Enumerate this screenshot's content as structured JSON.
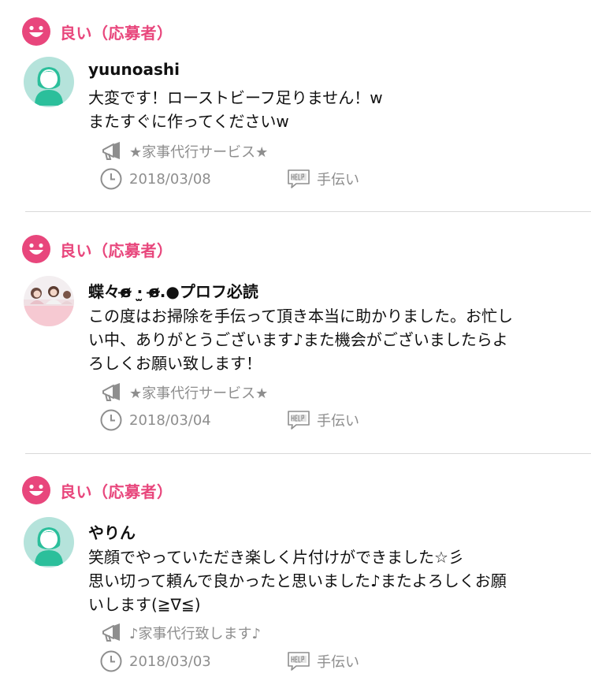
{
  "colors": {
    "accent": "#e8467c",
    "avatar_bg": "#b5e3db",
    "avatar_fg": "#2bbf9b",
    "meta": "#8e8e8e"
  },
  "icons": [
    "smiley-icon",
    "megaphone-icon",
    "clock-icon",
    "help-icon"
  ],
  "reviews": [
    {
      "rating": "良い（応募者）",
      "username": "yuunoashi",
      "comment_lines": [
        "大変です！ローストビーフ足りません！w",
        "またすぐに作ってくださいw"
      ],
      "job": "★家事代行サービス★",
      "date": "2018/03/08",
      "category": "手伝い"
    },
    {
      "rating": "良い（応募者）",
      "username": "蝶々ɞ̴̶̷ ·̫ ɞ̴̶̷.●プロフ必読",
      "comment_lines": [
        "この度はお掃除を手伝って頂き本当に助かりました。お忙し",
        "い中、ありがとうございます♪また機会がございましたらよ",
        "ろしくお願い致します！"
      ],
      "job": "★家事代行サービス★",
      "date": "2018/03/04",
      "category": "手伝い"
    },
    {
      "rating": "良い（応募者）",
      "username": "やりん",
      "comment_lines": [
        "笑顔でやっていただき楽しく片付けができました☆彡",
        "思い切って頼んで良かったと思いました♪またよろしくお願",
        "いします(≧∇≦)"
      ],
      "job": "♪家事代行致します♪",
      "date": "2018/03/03",
      "category": "手伝い"
    }
  ]
}
